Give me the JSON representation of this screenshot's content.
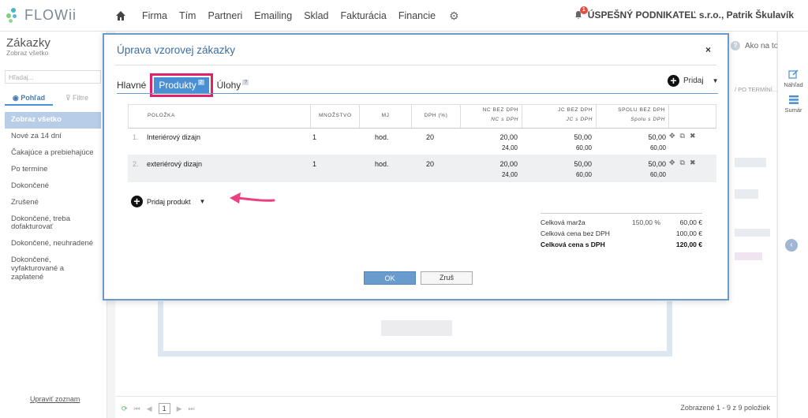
{
  "app": {
    "logo": "FLOWii"
  },
  "nav": {
    "items": [
      "Firma",
      "Tím",
      "Partneri",
      "Emailing",
      "Sklad",
      "Fakturácia",
      "Financie"
    ],
    "notification_count": "1",
    "company": "ÚSPEŠNÝ PODNIKATEĽ s.r.o., Patrik Škulavík"
  },
  "sidebar": {
    "title": "Zákazky",
    "subtitle": "Zobraz všetko",
    "search_placeholder": "Hľadaj...",
    "tab_view": "Pohľad",
    "tab_filters": "Filtre",
    "items": [
      "Zobraz všetko",
      "Nové za 14 dní",
      "Čakajúce a prebiehajúce",
      "Po termíne",
      "Dokončené",
      "Zrušené",
      "Dokončené, treba dofakturovať",
      "Dokončené, neuhradené",
      "Dokončené, vyfakturované a zaplatené"
    ],
    "footer": "Upraviť zoznam"
  },
  "help": {
    "label": "Ako na to?"
  },
  "right_rail": {
    "preview": "Náhľad",
    "summary": "Sumár"
  },
  "background": {
    "column_hint": "/ PO TERMÍNÍ..."
  },
  "footer": {
    "page": "1",
    "count_text": "Zobrazené 1 - 9 z 9 položiek"
  },
  "modal": {
    "title": "Úprava vzorovej zákazky",
    "close": "×",
    "tabs": [
      {
        "label": "Hlavné",
        "badge": ""
      },
      {
        "label": "Produkty",
        "badge": "2"
      },
      {
        "label": "Úlohy",
        "badge": "?"
      }
    ],
    "add_label": "Pridaj",
    "table": {
      "headers": {
        "item": "POLOŽKA",
        "qty": "MNOŽSTVO",
        "unit": "MJ",
        "vat": "DPH (%)",
        "nc": "NC BEZ DPH",
        "nc_sub": "NC s DPH",
        "jc": "JC BEZ DPH",
        "jc_sub": "JC s DPH",
        "total": "SPOLU BEZ DPH",
        "total_sub": "Spolu s DPH"
      },
      "rows": [
        {
          "idx": "1.",
          "name": "Interiérový dizajn",
          "qty": "1",
          "unit": "hod.",
          "vat": "20",
          "nc": "20,00",
          "nc_vat": "24,00",
          "jc": "50,00",
          "jc_vat": "60,00",
          "total": "50,00",
          "total_vat": "60,00"
        },
        {
          "idx": "2.",
          "name": "exteriérový dizajn",
          "qty": "1",
          "unit": "hod.",
          "vat": "20",
          "nc": "20,00",
          "nc_vat": "24,00",
          "jc": "50,00",
          "jc_vat": "60,00",
          "total": "50,00",
          "total_vat": "60,00"
        }
      ]
    },
    "add_product": "Pridaj produkt",
    "summary": {
      "margin_label": "Celková marža",
      "margin_pct": "150,00 %",
      "margin_val": "60,00 €",
      "net_label": "Celková cena bez DPH",
      "net_val": "100,00 €",
      "gross_label": "Celková cena s DPH",
      "gross_val": "120,00 €"
    },
    "ok": "OK",
    "cancel": "Zruš"
  },
  "colors": {
    "accent": "#4a8fd4",
    "highlight": "#e0206e",
    "modal_border": "#6a9bcd"
  }
}
